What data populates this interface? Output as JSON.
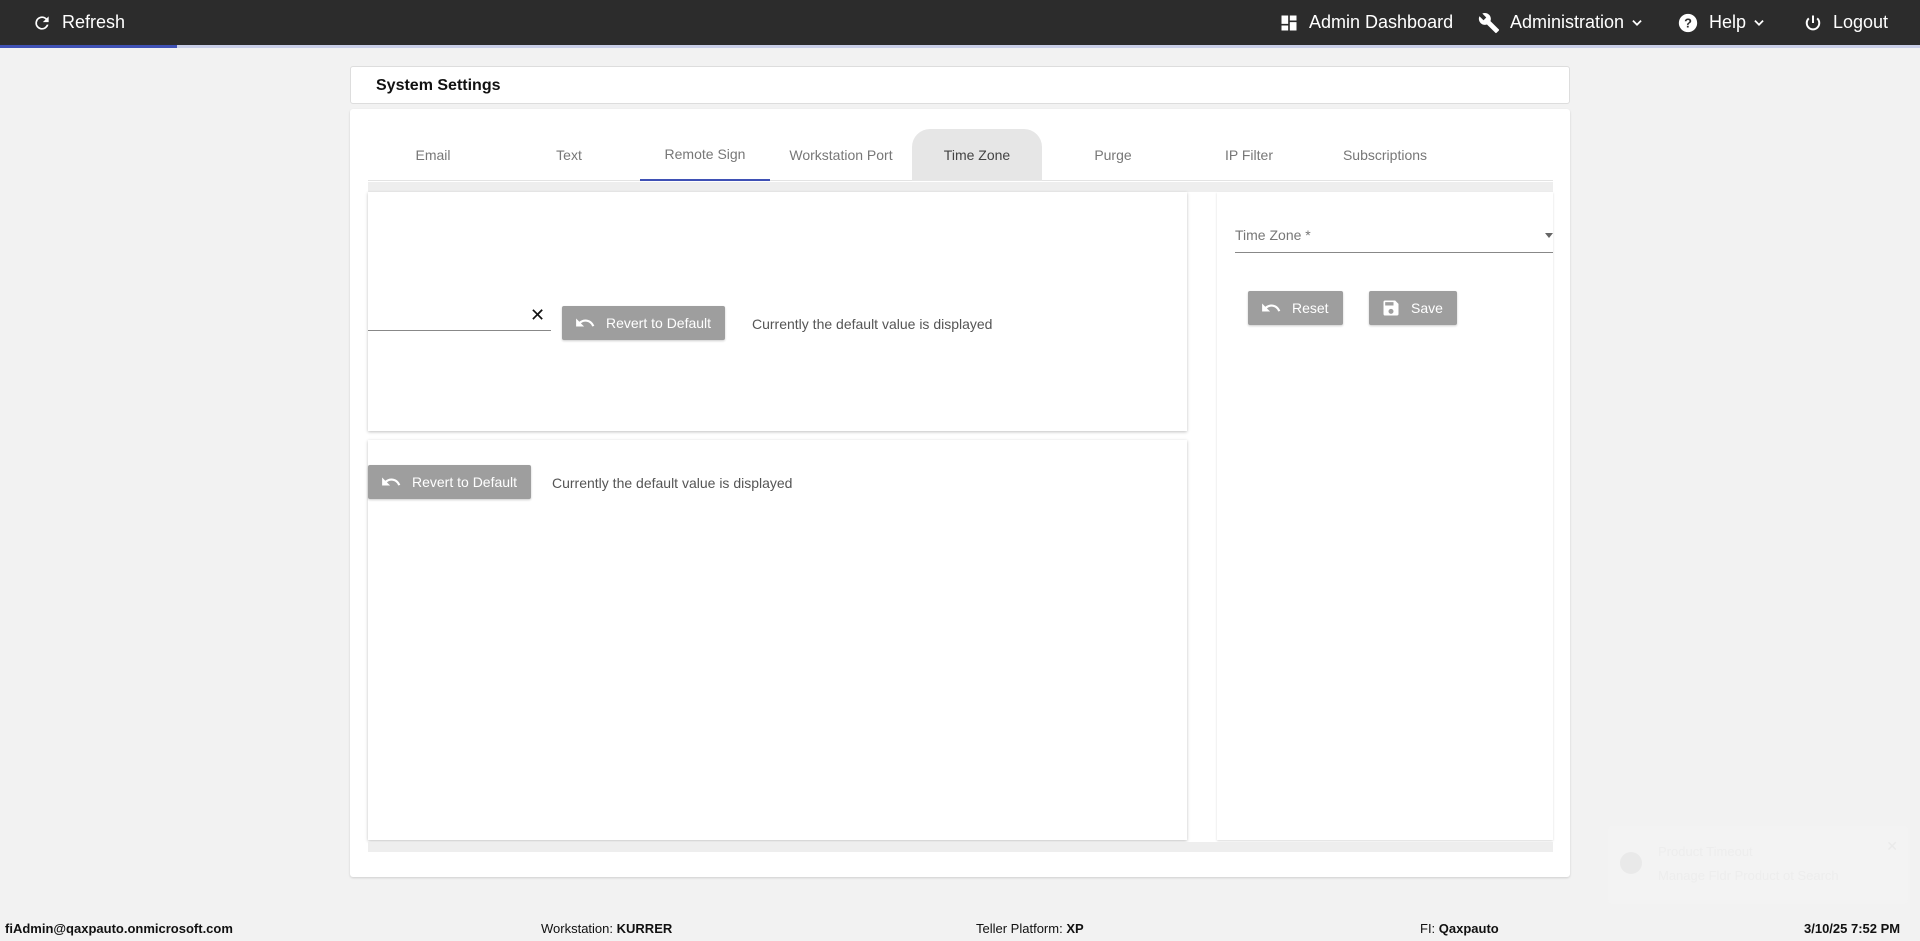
{
  "topbar": {
    "refresh_label": "Refresh",
    "admin_dashboard_label": "Admin Dashboard",
    "administration_label": "Administration",
    "help_label": "Help",
    "logout_label": "Logout",
    "progress_fraction": 0.092
  },
  "page": {
    "title": "System Settings"
  },
  "tabs": [
    {
      "label": "Email"
    },
    {
      "label": "Text"
    },
    {
      "label": "Remote Sign"
    },
    {
      "label": "Workstation Port"
    },
    {
      "label": "Time Zone"
    },
    {
      "label": "Purge"
    },
    {
      "label": "IP Filter"
    },
    {
      "label": "Subscriptions"
    }
  ],
  "panel_a": {
    "input_value": "",
    "clear_icon": "close-icon",
    "revert_label": "Revert to Default",
    "note": "Currently the default value is displayed"
  },
  "panel_b": {
    "revert_label": "Revert to Default",
    "note": "Currently the default value is displayed"
  },
  "timezone_panel": {
    "field_placeholder": "Time Zone *",
    "reset_label": "Reset",
    "save_label": "Save"
  },
  "toast": {
    "title": "Product Timeout",
    "message": "Manage Fldr Product ot Search"
  },
  "footer": {
    "user": "fiAdmin@qaxpauto.onmicrosoft.com",
    "workstation_label": "Workstation:",
    "workstation_value": "KURRER",
    "teller_label": "Teller Platform:",
    "teller_value": "XP",
    "fi_label": "FI:",
    "fi_value": "Qaxpauto",
    "datetime": "3/10/25 7:52 PM"
  },
  "colors": {
    "topbar": "#2c2c2c",
    "accent": "#3f51b5",
    "button_grey": "#9e9e9e"
  }
}
